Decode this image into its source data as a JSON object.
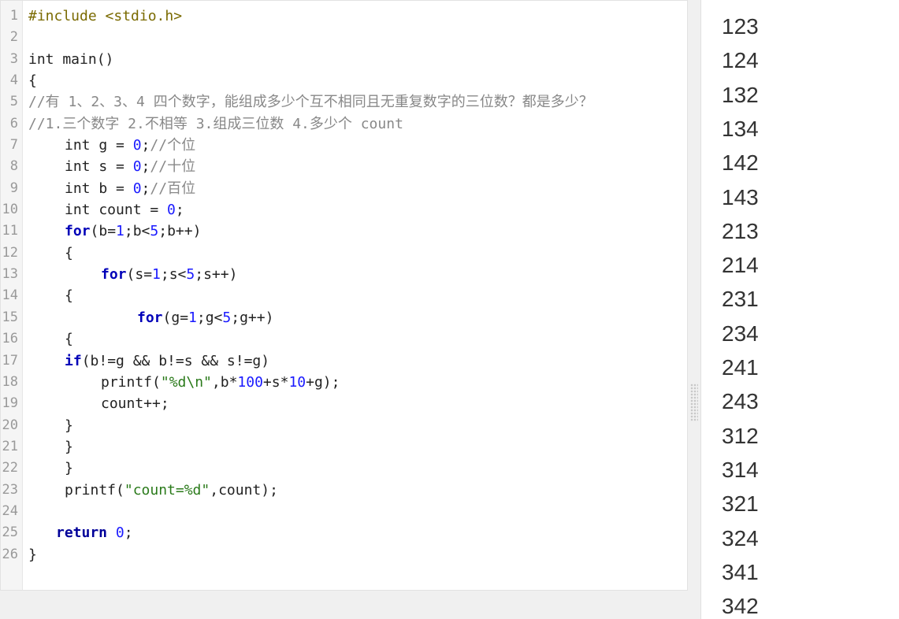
{
  "editor": {
    "line_numbers": [
      "1",
      "2",
      "3",
      "4",
      "5",
      "6",
      "7",
      "8",
      "9",
      "10",
      "11",
      "12",
      "13",
      "14",
      "15",
      "16",
      "17",
      "18",
      "19",
      "20",
      "21",
      "22",
      "23",
      "24",
      "25",
      "26"
    ],
    "code": {
      "l1": "#include <stdio.h>",
      "l3": "int main()",
      "l4": "{",
      "l5": "//有 1、2、3、4 四个数字，能组成多少个互不相同且无重复数字的三位数？都是多少？",
      "l6": "//1.三个数字 2.不相等 3.组成三位数 4.多少个 count",
      "l7_a": "int g = ",
      "l7_n": "0",
      "l7_b": ";",
      "l7_c": "//个位",
      "l8_a": "int s = ",
      "l8_n": "0",
      "l8_b": ";",
      "l8_c": "//十位",
      "l9_a": "int b = ",
      "l9_n": "0",
      "l9_b": ";",
      "l9_c": "//百位",
      "l10_a": "int count = ",
      "l10_n": "0",
      "l10_b": ";",
      "l11_kw": "for",
      "l11_a": "(b=",
      "l11_n1": "1",
      "l11_b": ";b<",
      "l11_n2": "5",
      "l11_c": ";b++)",
      "l12": "{",
      "l13_kw": "for",
      "l13_a": "(s=",
      "l13_n1": "1",
      "l13_b": ";s<",
      "l13_n2": "5",
      "l13_c": ";s++)",
      "l14": "{",
      "l15_kw": "for",
      "l15_a": "(g=",
      "l15_n1": "1",
      "l15_b": ";g<",
      "l15_n2": "5",
      "l15_c": ";g++)",
      "l16": "{",
      "l17_kw": "if",
      "l17_a": "(b!=g && b!=s && s!=g)",
      "l18_a": "printf(",
      "l18_s": "\"%d\\n\"",
      "l18_b": ",b*",
      "l18_n1": "100",
      "l18_c": "+s*",
      "l18_n2": "10",
      "l18_d": "+g);",
      "l19": "count++;",
      "l20": "}",
      "l21": "}",
      "l22": "}",
      "l23_a": "printf(",
      "l23_s": "\"count=%d\"",
      "l23_b": ",count);",
      "l25_kw": "return",
      "l25_n": "0",
      "l25_b": ";",
      "l26": "}"
    }
  },
  "output": {
    "lines": [
      "123",
      "124",
      "132",
      "134",
      "142",
      "143",
      "213",
      "214",
      "231",
      "234",
      "241",
      "243",
      "312",
      "314",
      "321",
      "324",
      "341",
      "342"
    ]
  }
}
